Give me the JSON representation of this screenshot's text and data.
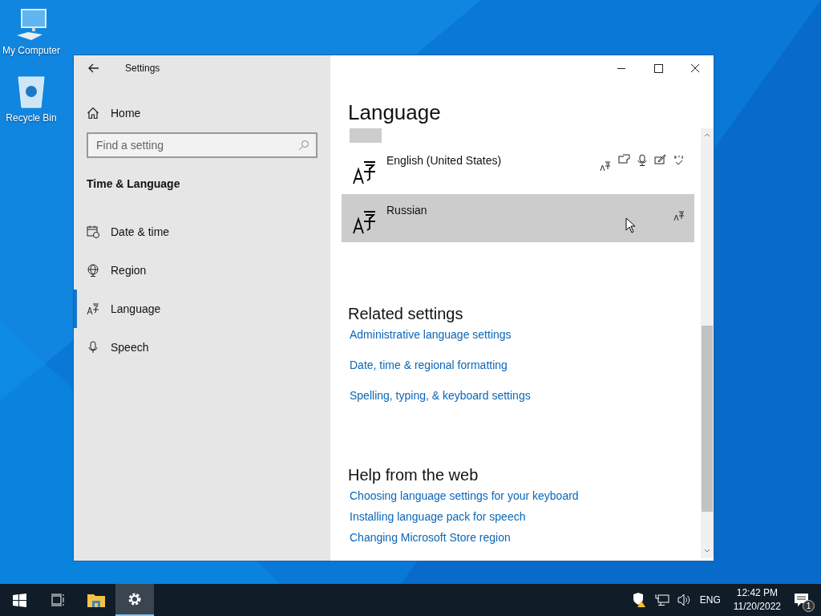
{
  "desktop_icons": [
    {
      "kind": "computer",
      "label": "My Computer"
    },
    {
      "kind": "recycle-bin",
      "label": "Recycle Bin"
    }
  ],
  "window": {
    "title": "Settings"
  },
  "sidebar": {
    "home": "Home",
    "search": {
      "placeholder": "Find a setting"
    },
    "section": "Time & Language",
    "items": [
      {
        "kind": "calendar",
        "label": "Date & time",
        "selected": false
      },
      {
        "kind": "globe",
        "label": "Region",
        "selected": false
      },
      {
        "kind": "language",
        "label": "Language",
        "selected": true
      },
      {
        "kind": "microphone",
        "label": "Speech",
        "selected": false
      }
    ]
  },
  "page": {
    "title": "Language",
    "languages": [
      {
        "name": "English (United States)",
        "selected": false,
        "features": [
          {
            "kind": "display-language"
          },
          {
            "kind": "text-to-speech"
          },
          {
            "kind": "speech"
          },
          {
            "kind": "handwriting"
          },
          {
            "kind": "spelling"
          }
        ]
      },
      {
        "name": "Russian",
        "selected": true,
        "features": [
          {
            "kind": "display-language"
          }
        ]
      }
    ],
    "related": {
      "heading": "Related settings",
      "links": [
        "Administrative language settings",
        "Date, time & regional formatting",
        "Spelling, typing, & keyboard settings"
      ]
    },
    "help": {
      "heading": "Help from the web",
      "links": [
        "Choosing language settings for your keyboard",
        "Installing language pack for speech",
        "Changing Microsoft Store region"
      ]
    }
  },
  "taskbar": {
    "apps": [
      {
        "kind": "start",
        "selected": false
      },
      {
        "kind": "task-view",
        "selected": false
      },
      {
        "kind": "explorer",
        "selected": false
      },
      {
        "kind": "settings",
        "selected": true
      }
    ],
    "language": "ENG",
    "time": "12:42 PM",
    "date": "11/20/2022",
    "notification_count": "1"
  }
}
